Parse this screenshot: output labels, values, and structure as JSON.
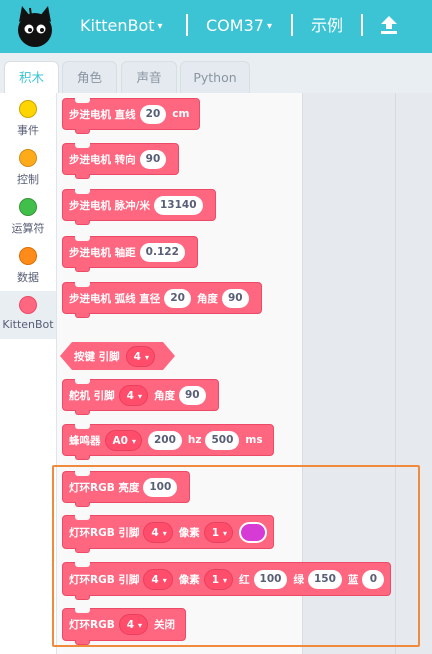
{
  "header": {
    "menu_device": "KittenBot",
    "menu_port": "COM37",
    "menu_examples": "示例",
    "caret": "▾"
  },
  "tabs": [
    "积木",
    "角色",
    "声音",
    "Python"
  ],
  "categories": [
    {
      "label": "事件",
      "color": "#ffd500"
    },
    {
      "label": "控制",
      "color": "#ffab19"
    },
    {
      "label": "运算符",
      "color": "#40bf4a"
    },
    {
      "label": "数据",
      "color": "#ff8c1a"
    },
    {
      "label": "KittenBot",
      "color": "#ff6680"
    }
  ],
  "blocks": {
    "stepper_line": {
      "label": "步进电机 直线",
      "value": "20",
      "unit": "cm"
    },
    "stepper_turn": {
      "label": "步进电机 转向",
      "value": "90"
    },
    "stepper_ppm": {
      "label": "步进电机 脉冲/米",
      "value": "13140"
    },
    "stepper_axle": {
      "label": "步进电机 轴距",
      "value": "0.122"
    },
    "stepper_arc": {
      "label": "步进电机 弧线 直径",
      "diameter": "20",
      "angle_label": "角度",
      "angle": "90"
    },
    "button": {
      "label": "按键 引脚",
      "pin": "4"
    },
    "servo": {
      "label": "舵机 引脚",
      "pin": "4",
      "angle_label": "角度",
      "angle": "90"
    },
    "buzzer": {
      "label": "蜂鸣器",
      "pin": "A0",
      "freq": "200",
      "freq_unit": "hz",
      "duration": "500",
      "duration_unit": "ms"
    },
    "rgb_brightness": {
      "label": "灯环RGB 亮度",
      "value": "100"
    },
    "rgb_pixel_color": {
      "label": "灯环RGB 引脚",
      "pin": "4",
      "pixel_label": "像素",
      "pixel": "1",
      "color": "#d63bd6"
    },
    "rgb_pixel_rgb": {
      "label": "灯环RGB 引脚",
      "pin": "4",
      "pixel_label": "像素",
      "pixel": "1",
      "r_label": "红",
      "r": "100",
      "g_label": "绿",
      "g": "150",
      "b_label": "蓝",
      "b": "0"
    },
    "rgb_off": {
      "label": "灯环RGB",
      "pin": "4",
      "action": "关闭"
    }
  },
  "colors": {
    "accent": "#3cc4d4",
    "block": "#ff6680",
    "highlight": "#f08a3c"
  }
}
